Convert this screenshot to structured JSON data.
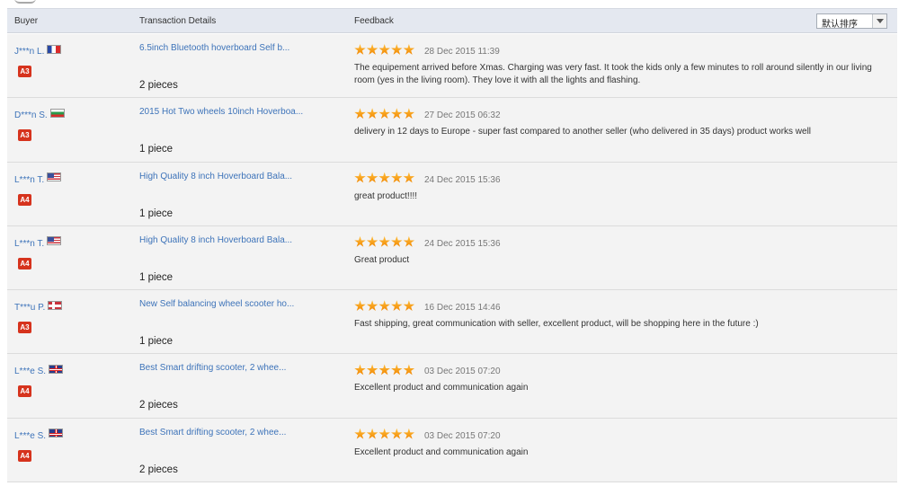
{
  "header": {
    "buyer": "Buyer",
    "transaction": "Transaction Details",
    "feedback": "Feedback",
    "sort_value": "默认排序"
  },
  "colors": {
    "link": "#3d73b9",
    "star": "#f08400",
    "badge": "#d6331d",
    "row_bg": "#f3f3f3"
  },
  "reviews": [
    {
      "buyer": "J***n L.",
      "flag": "fr",
      "level": "A3",
      "product": "6.5inch Bluetooth hoverboard Self b...",
      "quantity": "2 pieces",
      "stars": 5,
      "date": "28 Dec 2015 11:39",
      "comment": "The equipement arrived before Xmas. Charging was very fast. It took the kids only a few minutes to roll around silently in our living room (yes in the living room). They love it with all the lights and flashing."
    },
    {
      "buyer": "D***n S.",
      "flag": "bg",
      "level": "A3",
      "product": "2015 Hot Two wheels 10inch Hoverboa...",
      "quantity": "1 piece",
      "stars": 5,
      "date": "27 Dec 2015 06:32",
      "comment": "delivery in 12 days to Europe - super fast compared to another seller (who delivered in 35 days) product works well"
    },
    {
      "buyer": "L***n T.",
      "flag": "us",
      "level": "A4",
      "product": "High Quality 8 inch Hoverboard Bala...",
      "quantity": "1 piece",
      "stars": 5,
      "date": "24 Dec 2015 15:36",
      "comment": "great product!!!!"
    },
    {
      "buyer": "L***n T.",
      "flag": "us",
      "level": "A4",
      "product": "High Quality 8 inch Hoverboard Bala...",
      "quantity": "1 piece",
      "stars": 5,
      "date": "24 Dec 2015 15:36",
      "comment": "Great product"
    },
    {
      "buyer": "T***u P.",
      "flag": "no",
      "level": "A3",
      "product": "New Self balancing wheel scooter ho...",
      "quantity": "1 piece",
      "stars": 5,
      "date": "16 Dec 2015 14:46",
      "comment": "Fast shipping, great communication with seller, excellent product, will be shopping here in the future :)"
    },
    {
      "buyer": "L***e S.",
      "flag": "gb",
      "level": "A4",
      "product": "Best Smart drifting scooter, 2 whee...",
      "quantity": "2 pieces",
      "stars": 5,
      "date": "03 Dec 2015 07:20",
      "comment": "Excellent product and communication again"
    },
    {
      "buyer": "L***e S.",
      "flag": "gb",
      "level": "A4",
      "product": "Best Smart drifting scooter, 2 whee...",
      "quantity": "2 pieces",
      "stars": 5,
      "date": "03 Dec 2015 07:20",
      "comment": "Excellent product and communication again"
    }
  ]
}
